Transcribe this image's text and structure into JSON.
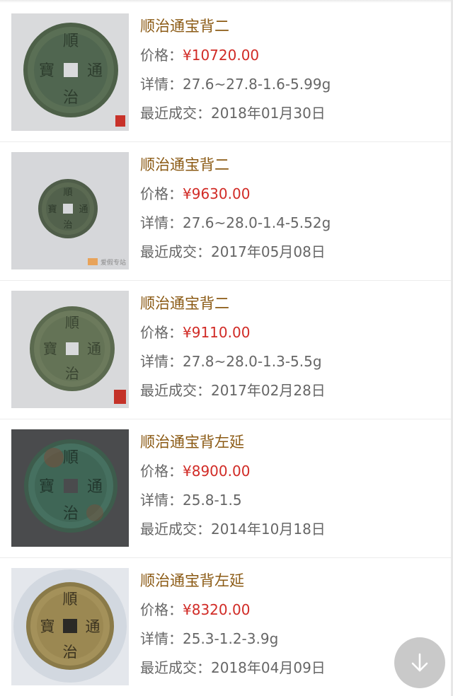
{
  "list": [
    {
      "title": "顺治通宝背二",
      "price_label": "价格：",
      "price_value": "¥10720.00",
      "detail_label": "详情：",
      "detail_value": "27.6~27.8-1.6-5.99g",
      "date_label": "最近成交：",
      "date_value": "2018年01月30日"
    },
    {
      "title": "顺治通宝背二",
      "price_label": "价格：",
      "price_value": "¥9630.00",
      "detail_label": "详情：",
      "detail_value": "27.6~28.0-1.4-5.52g",
      "date_label": "最近成交：",
      "date_value": "2017年05月08日"
    },
    {
      "title": "顺治通宝背二",
      "price_label": "价格：",
      "price_value": "¥9110.00",
      "detail_label": "详情：",
      "detail_value": "27.8~28.0-1.3-5.5g",
      "date_label": "最近成交：",
      "date_value": "2017年02月28日"
    },
    {
      "title": "顺治通宝背左延",
      "price_label": "价格：",
      "price_value": "¥8900.00",
      "detail_label": "详情：",
      "detail_value": "25.8-1.5",
      "date_label": "最近成交：",
      "date_value": "2014年10月18日"
    },
    {
      "title": "顺治通宝背左延",
      "price_label": "价格：",
      "price_value": "¥8320.00",
      "detail_label": "详情：",
      "detail_value": "25.3-1.2-3.9g",
      "date_label": "最近成交：",
      "date_value": "2018年04月09日"
    }
  ],
  "coin_chars": {
    "top": "順",
    "bottom": "治",
    "left": "寶",
    "right": "通"
  },
  "watermark_text": "爱假专站",
  "colors": {
    "title": "#8b5a14",
    "price": "#d12b26",
    "label": "#666666"
  },
  "fab_icon": "arrow-down-icon"
}
